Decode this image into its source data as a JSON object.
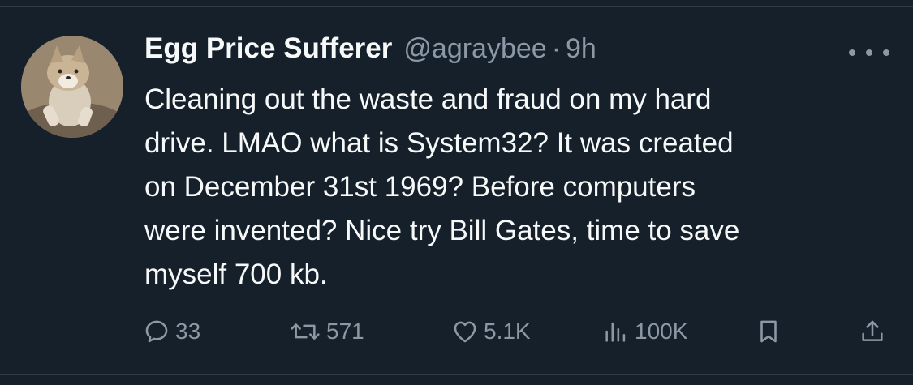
{
  "tweet": {
    "author_name": "Egg Price Sufferer",
    "handle": "@agraybee",
    "separator": "·",
    "time": "9h",
    "text_lines": [
      "Cleaning out the waste and fraud on my hard",
      "drive. LMAO what is System32? It was created",
      "on December 31st 1969? Before computers",
      "were invented? Nice try Bill Gates, time to save",
      "myself 700 kb."
    ]
  },
  "actions": {
    "replies": "33",
    "reposts": "571",
    "likes": "5.1K",
    "views": "100K"
  },
  "icons": {
    "reply": "reply-icon",
    "repost": "repost-icon",
    "like": "heart-icon",
    "views": "views-icon",
    "bookmark": "bookmark-icon",
    "share": "share-icon",
    "more": "more-icon"
  },
  "colors": {
    "background": "#15202b",
    "text": "#f7f9f9",
    "secondary": "#8b98a5"
  }
}
